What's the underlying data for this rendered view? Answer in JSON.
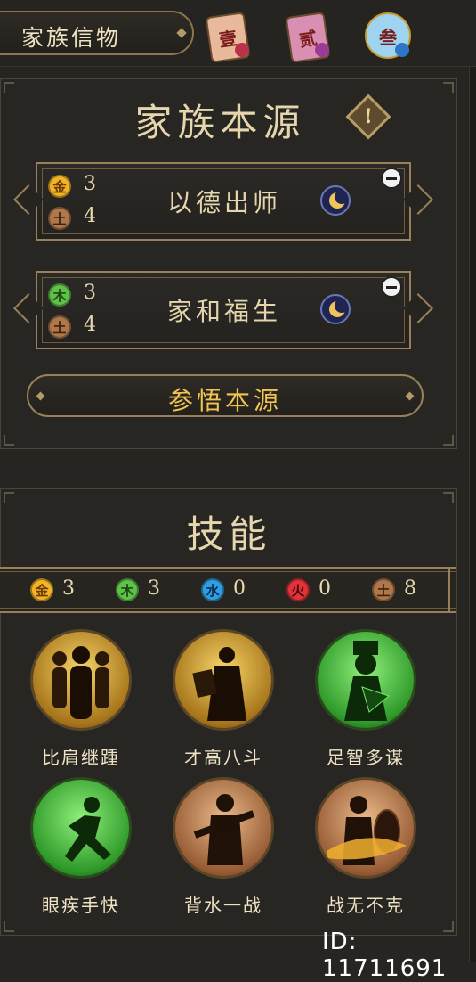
{
  "top_bar": {
    "title": "家族信物",
    "tokens": [
      {
        "label": "壹",
        "color": "#e8b99a",
        "bead": "#b8324a",
        "icon": "token-card-icon"
      },
      {
        "label": "贰",
        "color": "#d98fb2",
        "bead": "#9a3a9a",
        "icon": "token-card-icon"
      },
      {
        "label": "叁",
        "color": "#9ed4ef",
        "bead": "#2f74c6",
        "icon": "token-card-icon"
      }
    ]
  },
  "source_panel": {
    "title": "家族本源",
    "info_icon": "exclamation-icon",
    "rows": [
      {
        "name": "以德出师",
        "elements": [
          {
            "label": "金",
            "count": "3",
            "color": "#f2b327"
          },
          {
            "label": "土",
            "count": "4",
            "color": "#b0784a"
          }
        ],
        "icon": "moon-icon"
      },
      {
        "name": "家和福生",
        "elements": [
          {
            "label": "木",
            "count": "3",
            "color": "#5fc04a"
          },
          {
            "label": "土",
            "count": "4",
            "color": "#b0784a"
          }
        ],
        "icon": "moon-icon"
      }
    ],
    "comprehend_button": "参悟本源"
  },
  "skills_panel": {
    "title": "技能",
    "tally": [
      {
        "label": "金",
        "count": "3",
        "color": "#f2b327"
      },
      {
        "label": "木",
        "count": "3",
        "color": "#5fc04a"
      },
      {
        "label": "水",
        "count": "0",
        "color": "#2f9fe0"
      },
      {
        "label": "火",
        "count": "0",
        "color": "#e0333a"
      },
      {
        "label": "土",
        "count": "8",
        "color": "#b0784a"
      }
    ],
    "skills": [
      {
        "name": "比肩继踵",
        "tint": "gold"
      },
      {
        "name": "才高八斗",
        "tint": "gold"
      },
      {
        "name": "足智多谋",
        "tint": "green"
      },
      {
        "name": "眼疾手快",
        "tint": "green"
      },
      {
        "name": "背水一战",
        "tint": "bronze"
      },
      {
        "name": "战无不克",
        "tint": "bronze"
      }
    ]
  },
  "watermark": "ID: 11711691"
}
